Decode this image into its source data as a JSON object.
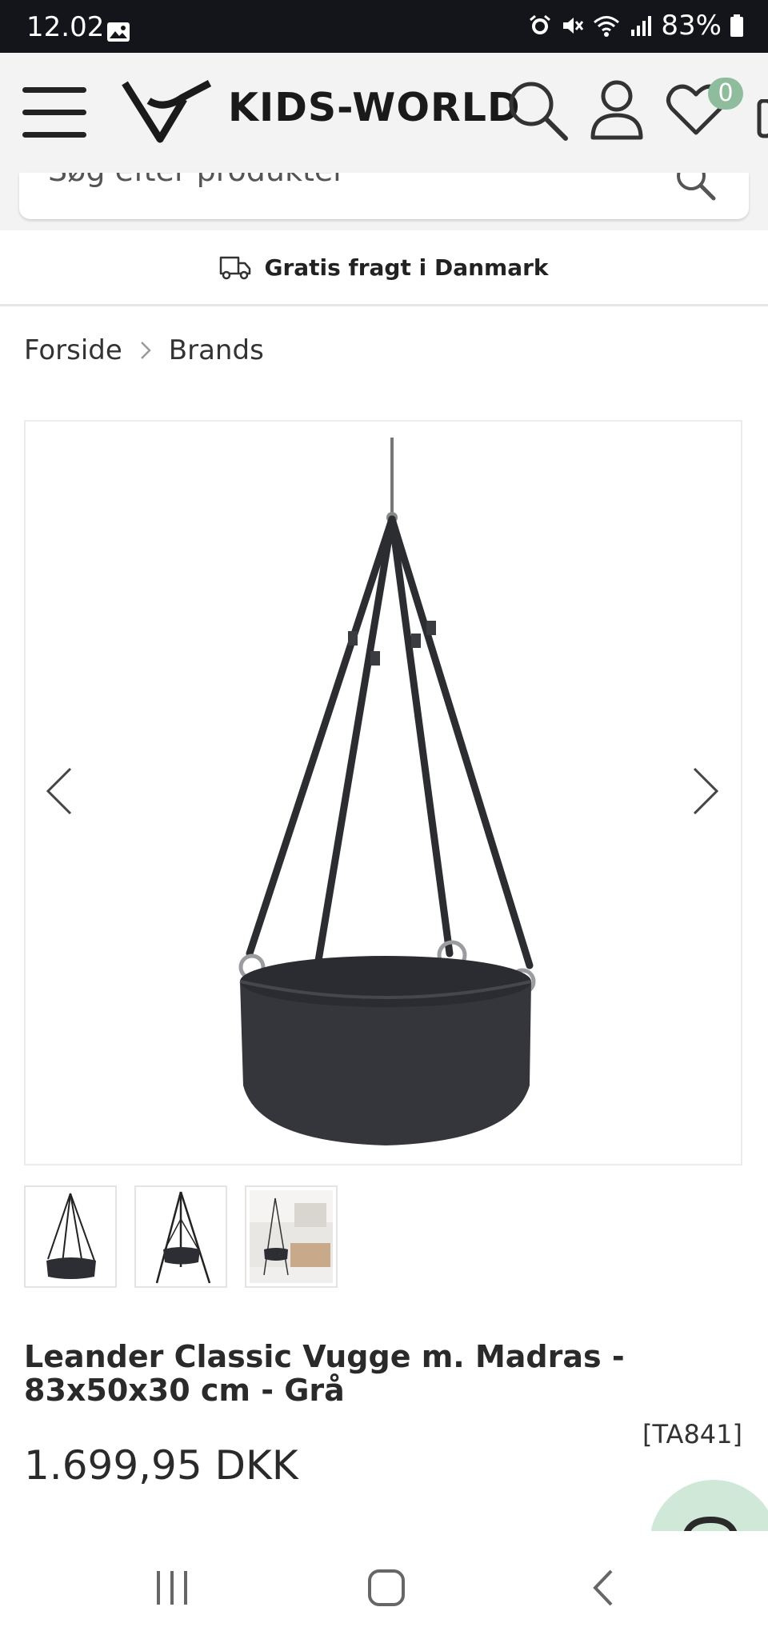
{
  "status": {
    "time": "12.02",
    "battery": "83%"
  },
  "header": {
    "brand": "KIDS-WORLD",
    "wishlist_count": "0"
  },
  "search": {
    "placeholder": "Søg efter produkter"
  },
  "shipping": {
    "text": "Gratis fragt i Danmark"
  },
  "breadcrumb": {
    "items": [
      "Forside",
      "Brands"
    ]
  },
  "product": {
    "title": "Leander Classic Vugge m. Madras - 83x50x30 cm - Grå",
    "sku": "[TA841]",
    "price": "1.699,95 DKK"
  },
  "colors": {
    "header_bg": "#f3f3f3",
    "badge": "#8fbc9c",
    "status_bar": "#14151a",
    "chat": "#cfe8d8"
  },
  "icons": [
    "menu-icon",
    "logo-icon",
    "search-icon",
    "account-icon",
    "heart-icon",
    "truck-icon",
    "chevron-left-icon",
    "chevron-right-icon",
    "recents-icon",
    "home-icon",
    "back-icon"
  ]
}
